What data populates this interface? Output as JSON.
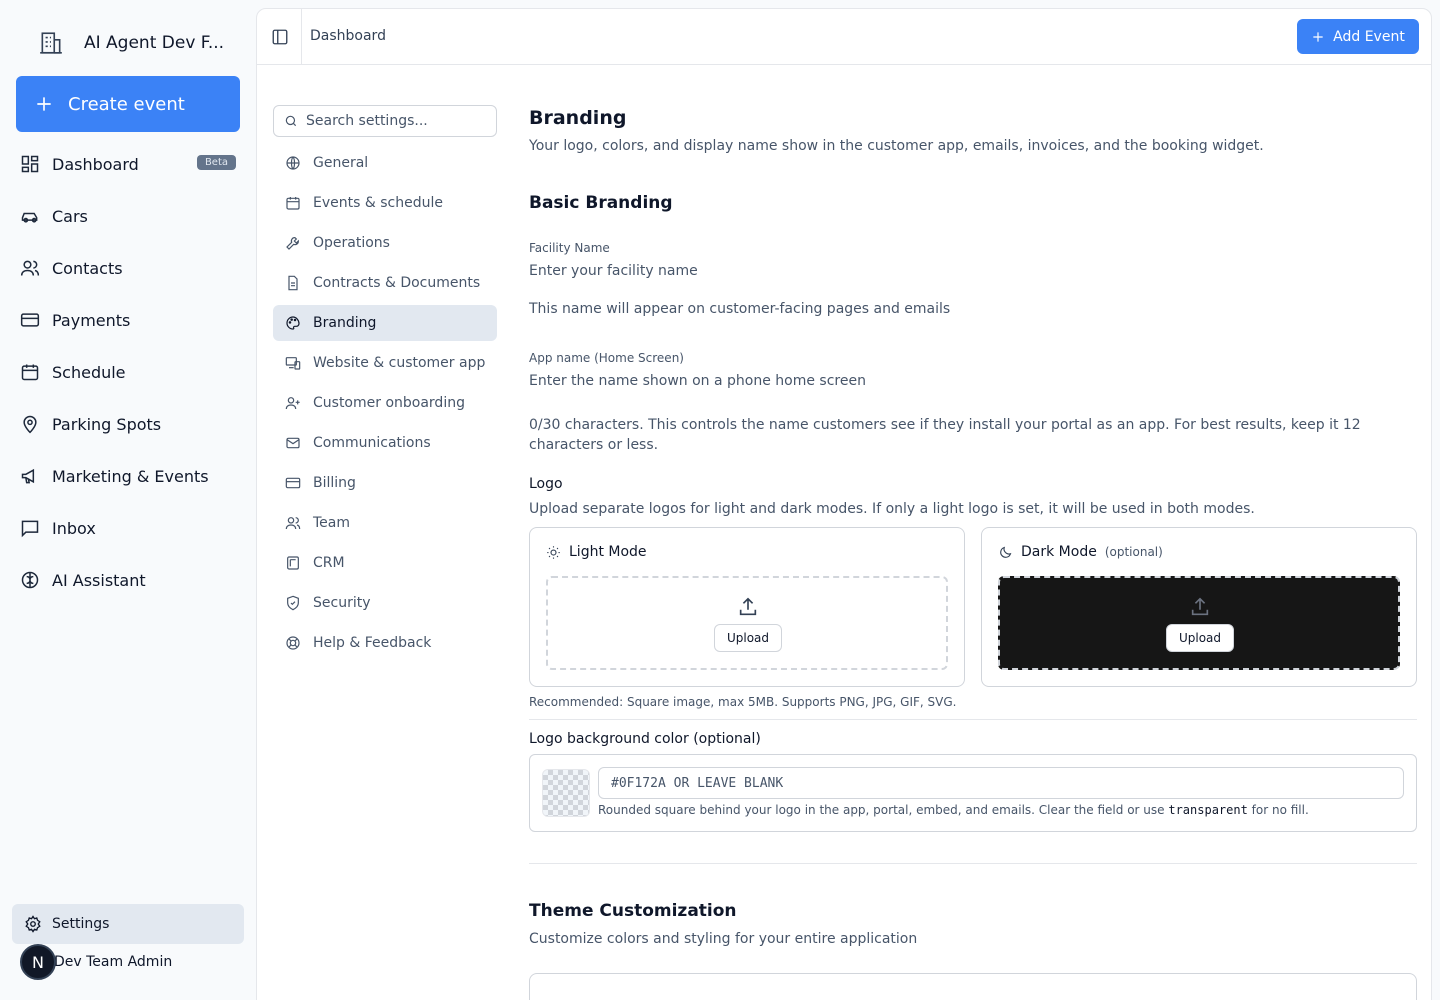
{
  "sidebar": {
    "org_name": "AI Agent Dev F...",
    "create_label": "Create event",
    "items": [
      {
        "label": "Dashboard",
        "badge": "Beta",
        "icon": "dashboard-grid-icon"
      },
      {
        "label": "Cars",
        "icon": "car-icon"
      },
      {
        "label": "Contacts",
        "icon": "users-icon"
      },
      {
        "label": "Payments",
        "icon": "credit-card-icon"
      },
      {
        "label": "Schedule",
        "icon": "calendar-icon"
      },
      {
        "label": "Parking Spots",
        "icon": "map-pin-icon"
      },
      {
        "label": "Marketing & Events",
        "icon": "megaphone-icon"
      },
      {
        "label": "Inbox",
        "icon": "message-square-icon"
      },
      {
        "label": "AI Assistant",
        "icon": "brain-icon"
      }
    ],
    "settings_label": "Settings",
    "user_initial": "N",
    "user_name": "Dev Team Admin"
  },
  "topbar": {
    "breadcrumb": "Dashboard",
    "add_label": "Add Event"
  },
  "settings_nav": {
    "search_placeholder": "Search settings...",
    "items": [
      {
        "label": "General",
        "icon": "globe-icon"
      },
      {
        "label": "Events & schedule",
        "icon": "calendar-icon"
      },
      {
        "label": "Operations",
        "icon": "wrench-icon"
      },
      {
        "label": "Contracts & Documents",
        "icon": "file-text-icon"
      },
      {
        "label": "Branding",
        "icon": "palette-icon",
        "active": true
      },
      {
        "label": "Website & customer app",
        "icon": "devices-icon"
      },
      {
        "label": "Customer onboarding",
        "icon": "user-plus-icon"
      },
      {
        "label": "Communications",
        "icon": "mail-icon"
      },
      {
        "label": "Billing",
        "icon": "credit-card-icon"
      },
      {
        "label": "Team",
        "icon": "users-icon"
      },
      {
        "label": "CRM",
        "icon": "crm-icon"
      },
      {
        "label": "Security",
        "icon": "shield-icon"
      },
      {
        "label": "Help & Feedback",
        "icon": "life-buoy-icon"
      }
    ]
  },
  "content": {
    "title": "Branding",
    "subtitle": "Your logo, colors, and display name show in the customer app, emails, invoices, and the booking widget.",
    "basic_title": "Basic Branding",
    "facility_label": "Facility Name",
    "facility_placeholder": "Enter your facility name",
    "facility_help": "This name will appear on customer-facing pages and emails",
    "app_name_label": "App name (Home Screen)",
    "app_name_placeholder": "Enter the name shown on a phone home screen",
    "app_name_help": "0/30 characters. This controls the name customers see if they install your portal as an app. For best results, keep it 12 characters or less.",
    "logo_label": "Logo",
    "logo_help": "Upload separate logos for light and dark modes. If only a light logo is set, it will be used in both modes.",
    "light_mode_label": "Light Mode",
    "dark_mode_label": "Dark Mode",
    "dark_mode_optional": "(optional)",
    "upload_label": "Upload",
    "recommended": "Recommended: Square image, max 5MB. Supports PNG, JPG, GIF, SVG.",
    "logo_bg_label": "Logo background color (optional)",
    "logo_bg_placeholder": "#0F172A OR LEAVE BLANK",
    "logo_bg_help_a": "Rounded square behind your logo in the app, portal, embed, and emails. Clear the field or use ",
    "logo_bg_help_code": "transparent",
    "logo_bg_help_b": " for no fill.",
    "theme_title": "Theme Customization",
    "theme_subtitle": "Customize colors and styling for your entire application"
  },
  "colors": {
    "accent": "#3b82f6",
    "active_bg": "#e2e8f0",
    "dark_drop": "#161616"
  }
}
